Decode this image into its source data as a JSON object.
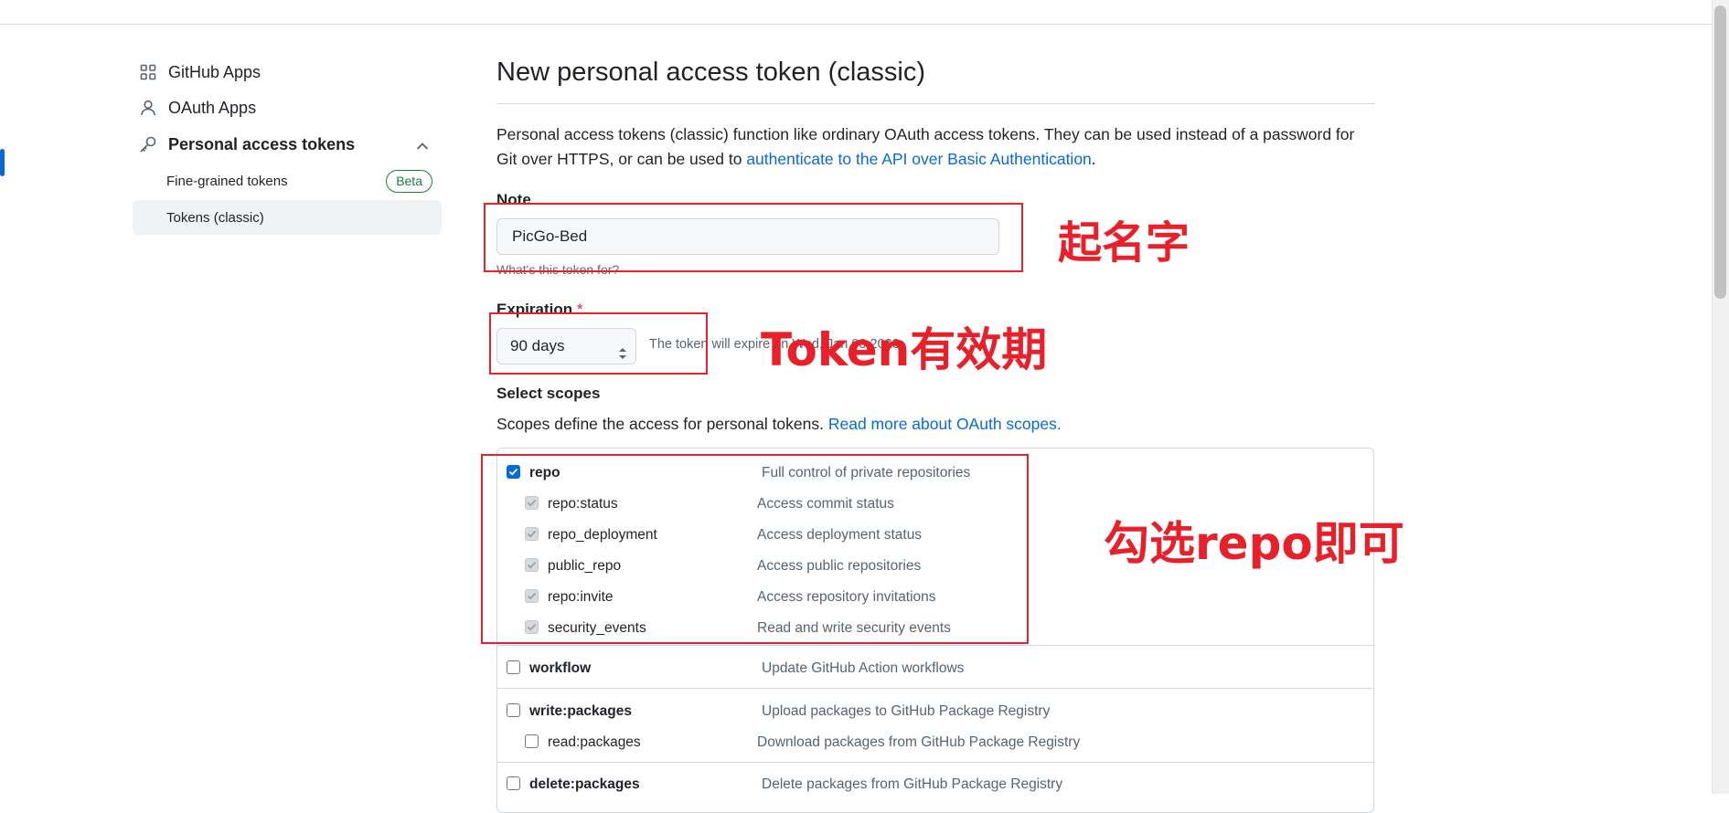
{
  "sidebar": {
    "items": [
      {
        "label": "GitHub Apps",
        "icon": "apps-grid-icon"
      },
      {
        "label": "OAuth Apps",
        "icon": "person-icon"
      },
      {
        "label": "Personal access tokens",
        "icon": "key-icon"
      }
    ],
    "sub_items": [
      {
        "label": "Fine-grained tokens",
        "badge": "Beta"
      },
      {
        "label": "Tokens (classic)"
      }
    ]
  },
  "main": {
    "title": "New personal access token (classic)",
    "intro_text": "Personal access tokens (classic) function like ordinary OAuth access tokens. They can be used instead of a password for Git over HTTPS, or can be used to ",
    "intro_link": "authenticate to the API over Basic Authentication",
    "intro_end": ".",
    "note": {
      "label": "Note",
      "value": "PicGo-Bed",
      "hint": "What's this token for?"
    },
    "expiration": {
      "label": "Expiration",
      "required_mark": "*",
      "selected": "90 days",
      "note": "The token will expire on Wed, Jan 03 2023"
    },
    "scopes": {
      "label": "Select scopes",
      "description": "Scopes define the access for personal tokens. ",
      "link": "Read more about OAuth scopes.",
      "items": [
        {
          "name": "repo",
          "desc": "Full control of private repositories",
          "checked": true,
          "level": 0
        },
        {
          "name": "repo:status",
          "desc": "Access commit status",
          "checked": true,
          "level": 1
        },
        {
          "name": "repo_deployment",
          "desc": "Access deployment status",
          "checked": true,
          "level": 1
        },
        {
          "name": "public_repo",
          "desc": "Access public repositories",
          "checked": true,
          "level": 1
        },
        {
          "name": "repo:invite",
          "desc": "Access repository invitations",
          "checked": true,
          "level": 1
        },
        {
          "name": "security_events",
          "desc": "Read and write security events",
          "checked": true,
          "level": 1
        },
        {
          "name": "workflow",
          "desc": "Update GitHub Action workflows",
          "checked": false,
          "level": 0
        },
        {
          "name": "write:packages",
          "desc": "Upload packages to GitHub Package Registry",
          "checked": false,
          "level": 0
        },
        {
          "name": "read:packages",
          "desc": "Download packages from GitHub Package Registry",
          "checked": false,
          "level": 1
        },
        {
          "name": "delete:packages",
          "desc": "Delete packages from GitHub Package Registry",
          "checked": false,
          "level": 0
        }
      ]
    }
  },
  "annotations": {
    "note": "起名字",
    "expiration": "Token有效期",
    "scopes": "勾选repo即可"
  },
  "colors": {
    "accent": "#0969da",
    "annotation": "#e8202a",
    "beta": "#1a7f37"
  }
}
